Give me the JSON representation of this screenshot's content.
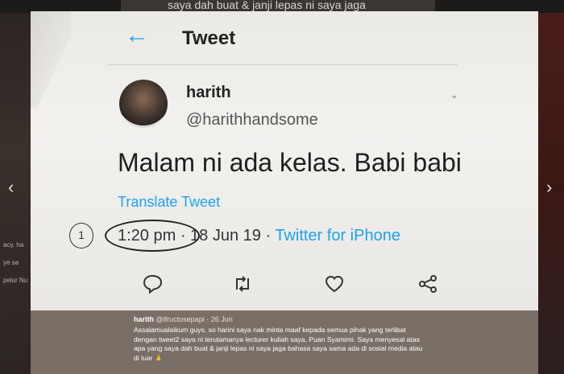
{
  "top_caption": "saya dah buat & janji lepas ni saya jaga",
  "side": {
    "line1": "acy. ha",
    "line2": "ye sa",
    "line3": "pelur Nu"
  },
  "tweet": {
    "header_title": "Tweet",
    "name": "harith",
    "handle": "@harithhandsome",
    "text": "Malam ni ada kelas. Babi babi",
    "translate": "Translate Tweet",
    "time": "1:20 pm",
    "date_sep": " · 18 Jun 19 · ",
    "source": "Twitter for iPhone",
    "annotation_number": "1"
  },
  "colors": {
    "twitter_blue": "#1da1f2",
    "footer_bg": "#7a6f66"
  },
  "icons": [
    "back-arrow-icon",
    "chevron-down-icon",
    "reply-icon",
    "retweet-icon",
    "like-icon",
    "share-icon",
    "prev-arrow-icon",
    "next-arrow-icon"
  ],
  "footer": {
    "username": "harith",
    "handle": "@ifructosepapi",
    "date": " · 26 Jun",
    "text": "Assalamualaikum guys, so harini saya nak minta maaf kepada semua pihak yang terlibat dengan tweet2 saya ni terutamanya lecturer kuliah saya, Puan Syamimi. Saya menyesal atas apa yang saya dah buat & janji lepas ni saya jaga bahasa saya sama ada di sosial media atau di luar 🙏"
  }
}
